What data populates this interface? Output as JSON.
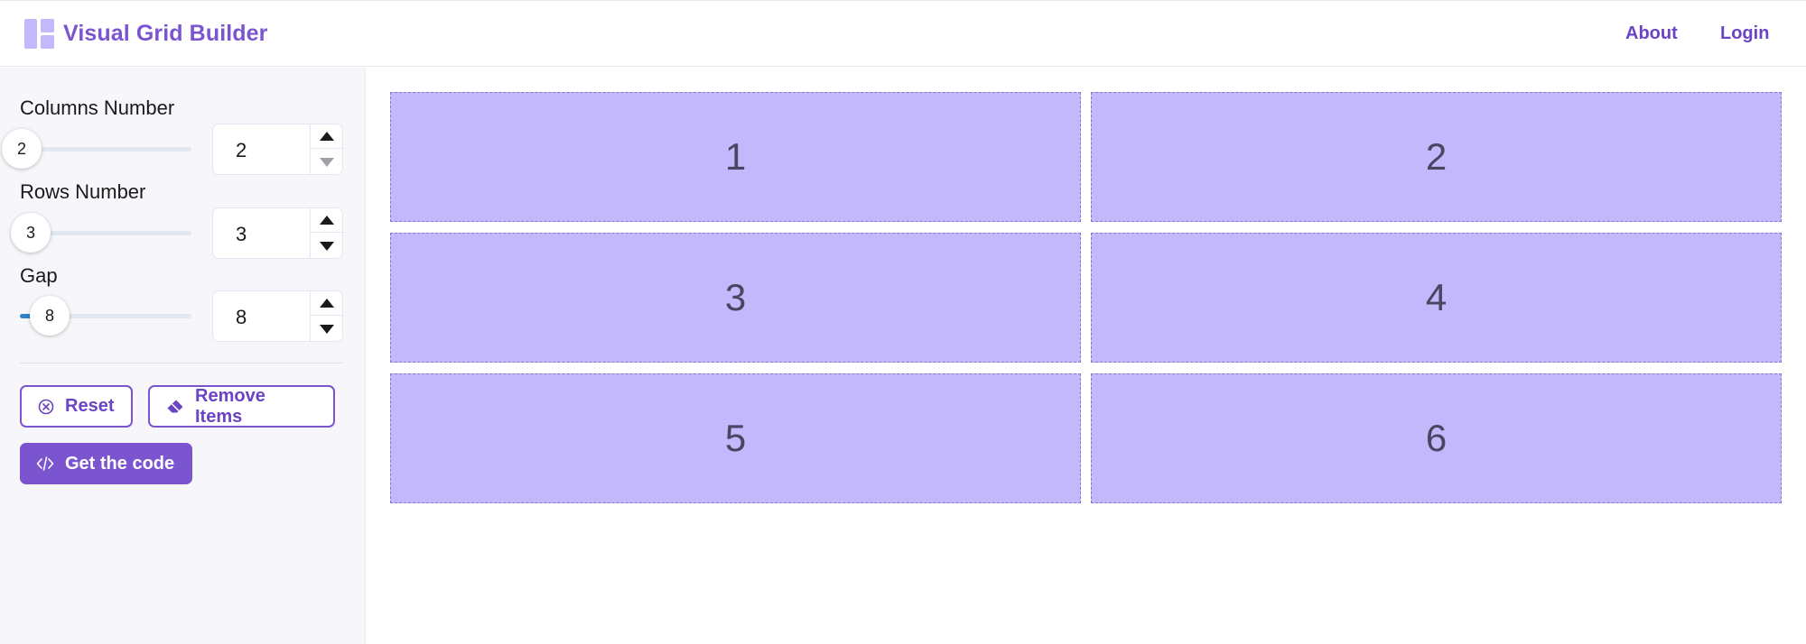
{
  "header": {
    "title": "Visual Grid Builder",
    "nav": {
      "about": "About",
      "login": "Login"
    }
  },
  "controls": {
    "columns": {
      "label": "Columns Number",
      "value": "2",
      "slider_fraction": 0.0
    },
    "rows": {
      "label": "Rows Number",
      "value": "3",
      "slider_fraction": 0.03
    },
    "gap": {
      "label": "Gap",
      "value": "8",
      "slider_fraction": 0.14
    }
  },
  "actions": {
    "reset": "Reset",
    "remove_items": "Remove Items",
    "get_code": "Get the code"
  },
  "grid": {
    "items": [
      "1",
      "2",
      "3",
      "4",
      "5",
      "6"
    ]
  },
  "colors": {
    "accent": "#7b55cf",
    "cell_fill": "#c4b8fc",
    "slider_fill": "#3182ce",
    "sidebar_bg": "#f7f7fb"
  },
  "icons": {
    "logo": "layout-grid-icon",
    "reset": "close-circle-icon",
    "remove_items": "eraser-icon",
    "get_code": "code-icon",
    "step_up": "triangle-up-icon",
    "step_down": "triangle-down-icon"
  }
}
